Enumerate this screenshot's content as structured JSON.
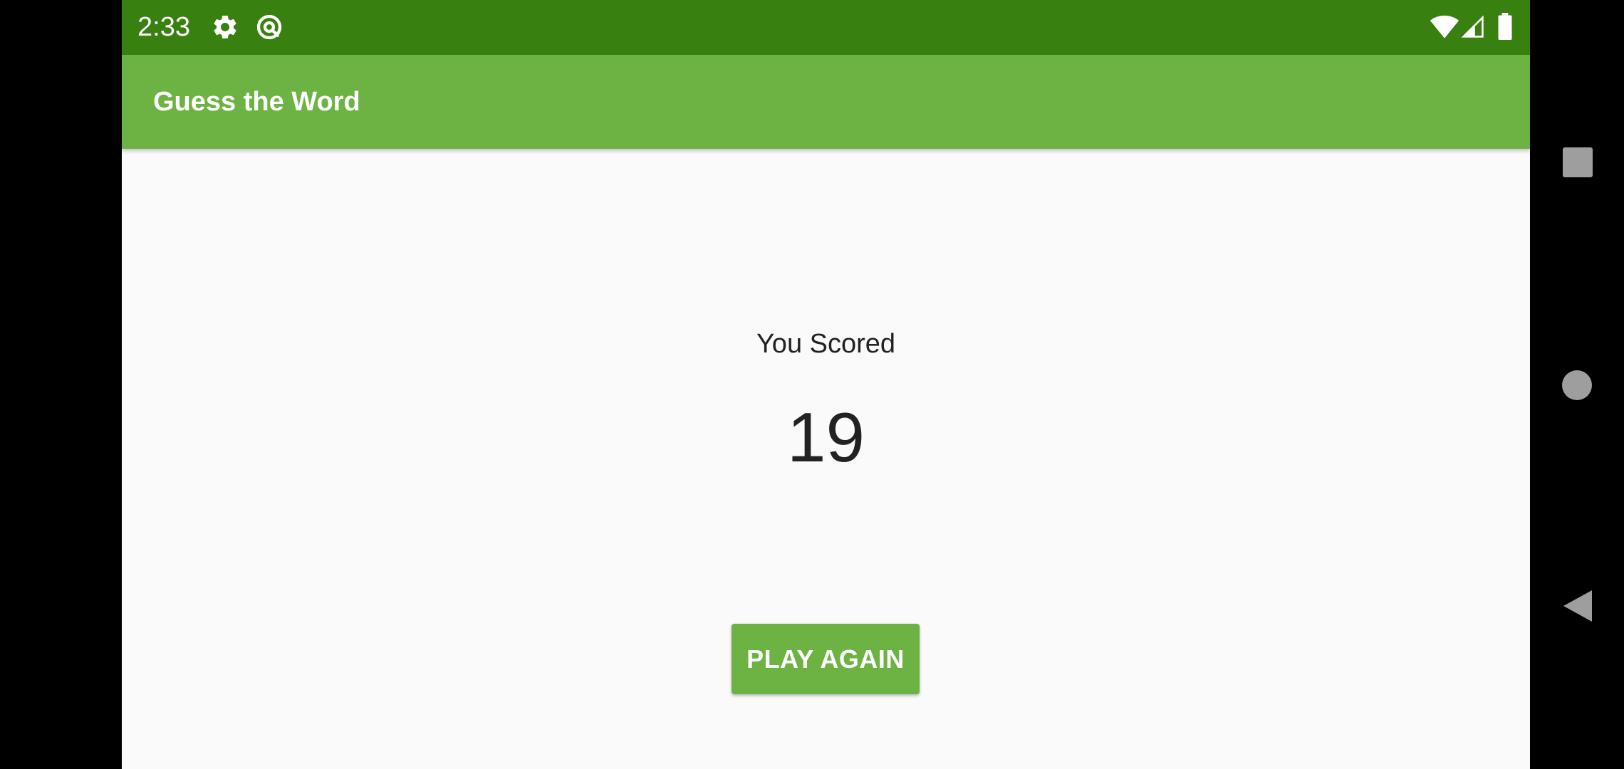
{
  "status_bar": {
    "time": "2:33",
    "icons": [
      "settings-icon",
      "sync-icon",
      "wifi-icon",
      "signal-icon",
      "battery-icon"
    ],
    "color": "#38800f"
  },
  "app_bar": {
    "title": "Guess the Word",
    "color": "#6cb343"
  },
  "score": {
    "label": "You Scored",
    "value": "19"
  },
  "play_again_button": {
    "label": "PLAY AGAIN",
    "color": "#6cb343"
  },
  "nav_bar": {
    "buttons": [
      "recents-icon",
      "home-icon",
      "back-icon"
    ]
  }
}
